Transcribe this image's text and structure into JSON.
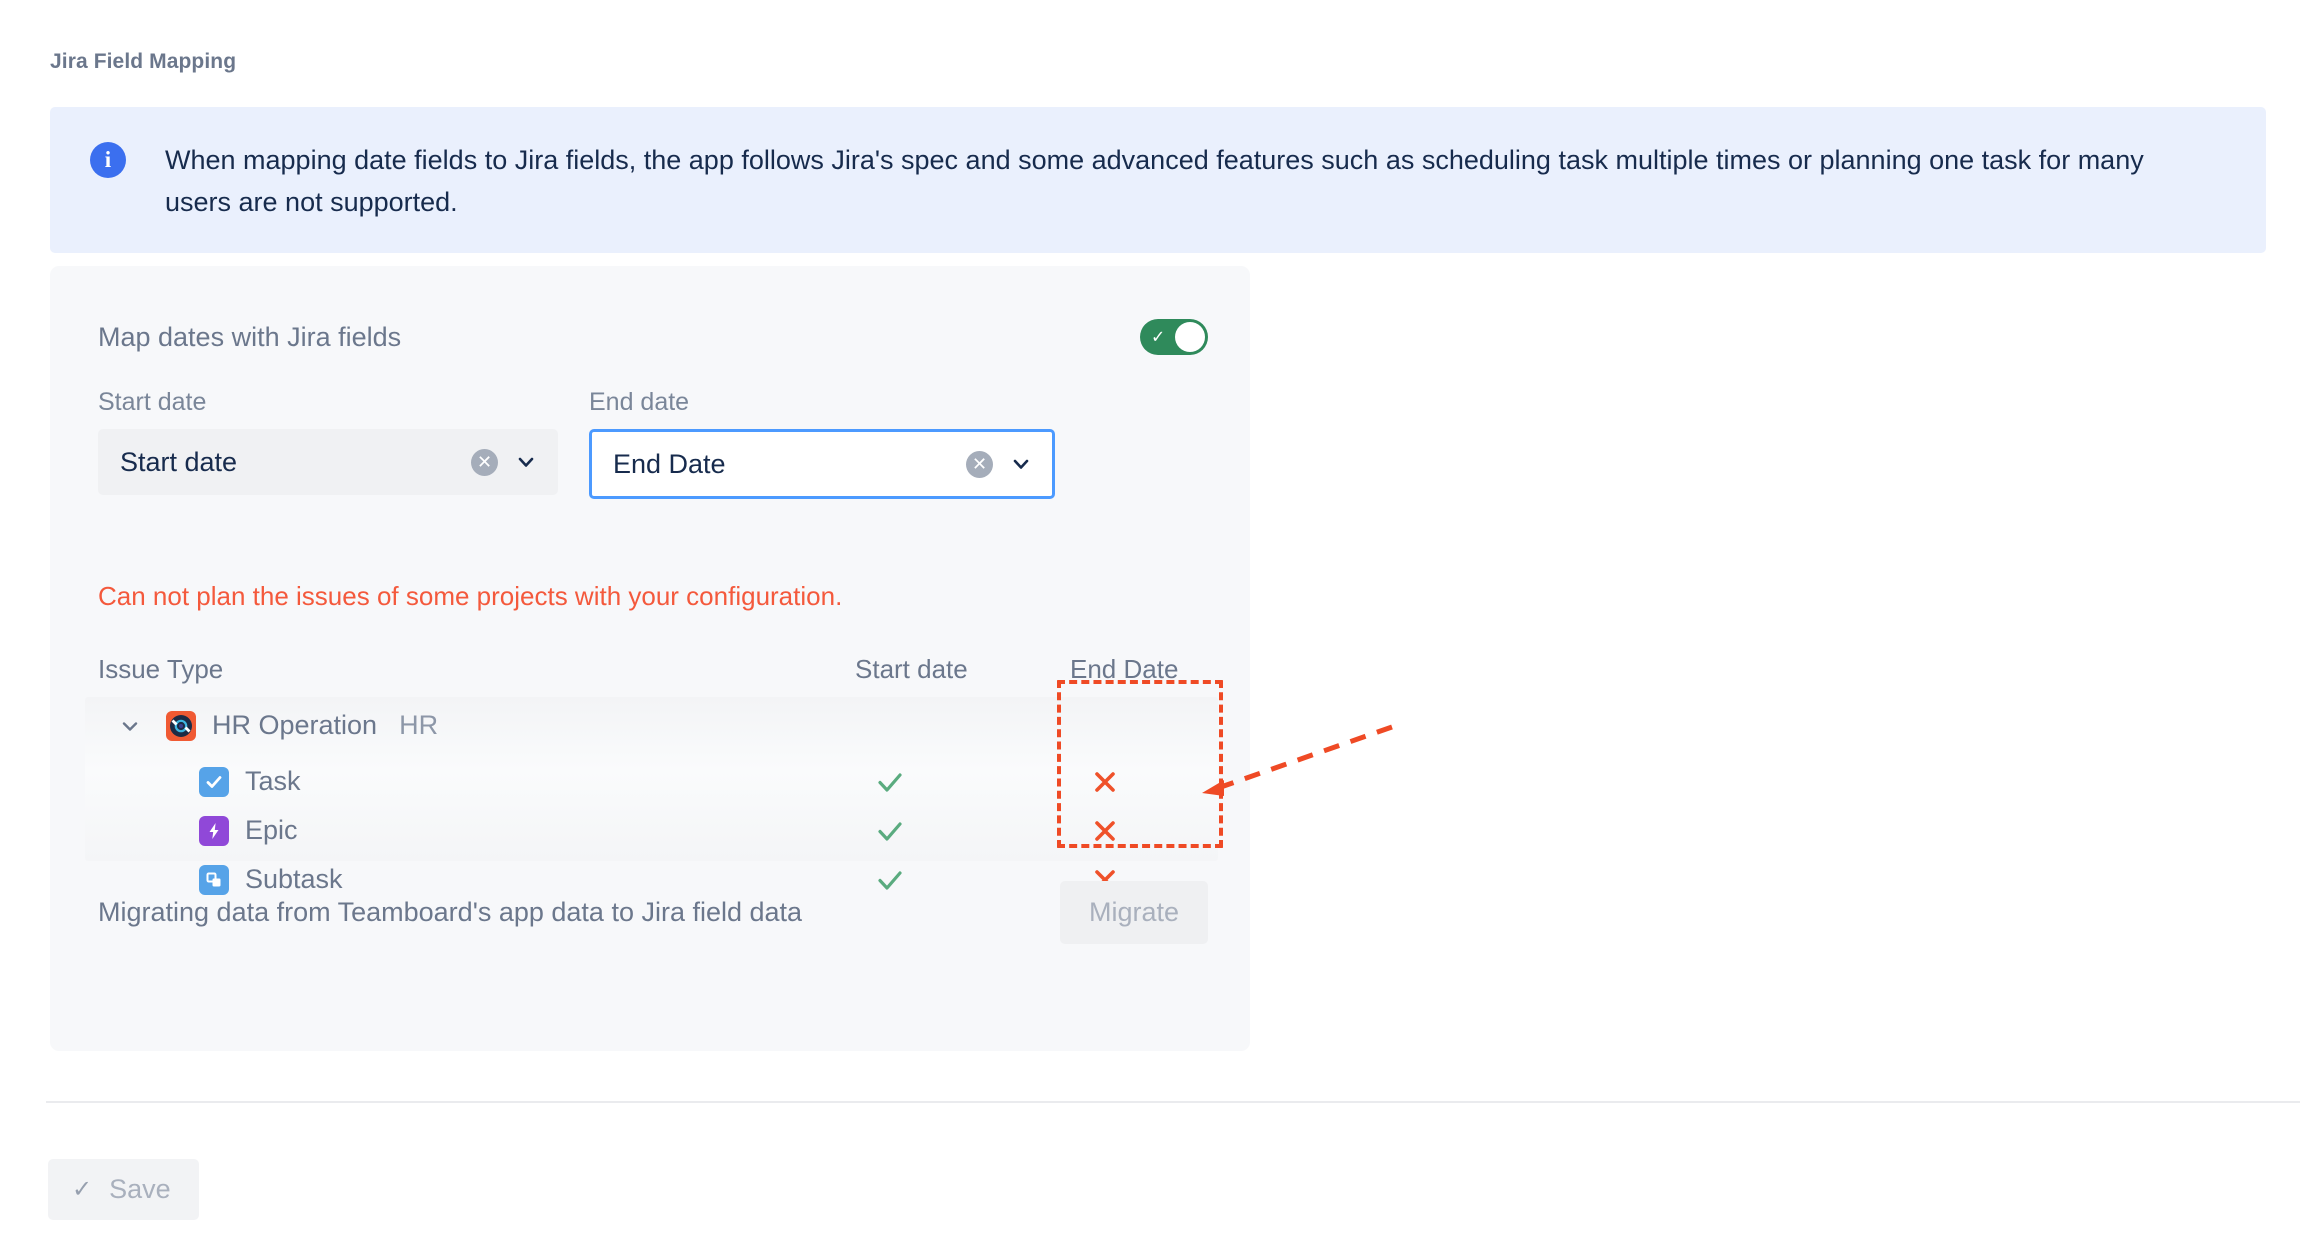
{
  "page": {
    "title": "Jira Field Mapping"
  },
  "banner": {
    "icon": "info-icon",
    "text": "When mapping date fields to Jira fields, the app follows Jira's spec and some advanced features such as scheduling task multiple times or planning one task for many users are not supported."
  },
  "card": {
    "toggle": {
      "label": "Map dates with Jira fields",
      "state": "on",
      "color": "#2f8a5b"
    },
    "fields": {
      "start": {
        "label": "Start date",
        "value": "Start date",
        "clear_icon": "clear-circle-icon",
        "chevron_icon": "chevron-down-icon",
        "focused": "false"
      },
      "end": {
        "label": "End date",
        "value": "End Date",
        "clear_icon": "clear-circle-icon",
        "chevron_icon": "chevron-down-icon",
        "focused": "true"
      }
    },
    "error": {
      "text": "Can not plan the issues of some projects with your configuration.",
      "color": "#f4593c"
    },
    "table": {
      "columns": [
        "Issue Type",
        "Start date",
        "End Date"
      ],
      "group": {
        "name": "HR Operation",
        "key": "HR",
        "icon": "vinyl-record-project-icon",
        "icon_color": "#f05a33",
        "expanded": "true"
      },
      "rows": [
        {
          "name": "Task",
          "icon": "task-check-icon",
          "icon_color": "#56a3e8",
          "start": "check",
          "end": "cross"
        },
        {
          "name": "Epic",
          "icon": "epic-bolt-icon",
          "icon_color": "#9048d8",
          "start": "check",
          "end": "cross"
        },
        {
          "name": "Subtask",
          "icon": "subtask-layers-icon",
          "icon_color": "#56a3e8",
          "start": "check",
          "end": "cross"
        }
      ],
      "marks": {
        "check_color": "#5aab7f",
        "cross_color": "#ef512a"
      }
    },
    "migrate": {
      "text": "Migrating data from Teamboard's app data to Jira field data",
      "button_label": "Migrate"
    }
  },
  "footer": {
    "save_label": "Save",
    "save_icon": "check-icon"
  },
  "annotation": {
    "box_color": "#ef4a25",
    "arrow_color": "#ef4a25"
  }
}
